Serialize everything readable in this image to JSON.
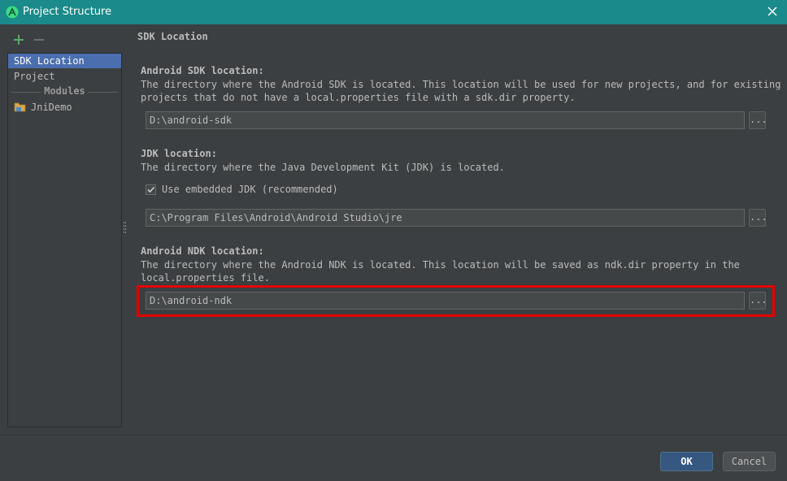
{
  "window": {
    "title": "Project Structure",
    "app_icon": "android-studio-icon",
    "close_icon": "close-icon"
  },
  "toolbar": {
    "add_icon": "plus-icon",
    "remove_icon": "minus-icon",
    "add_color": "#59a869"
  },
  "sidebar": {
    "items": [
      {
        "label": "SDK Location",
        "selected": true
      },
      {
        "label": "Project",
        "selected": false
      }
    ],
    "section_label": "Modules",
    "modules": [
      {
        "label": "JniDemo",
        "icon": "module-folder-icon"
      }
    ]
  },
  "main": {
    "section_title": "SDK Location",
    "sdk": {
      "heading": "Android SDK location:",
      "description_line1": "The directory where the Android SDK is located. This location will be used for new projects, and for existing",
      "description_line2": "projects that do not have a local.properties file with a sdk.dir property.",
      "path": "D:\\android-sdk",
      "browse_label": "..."
    },
    "jdk": {
      "heading": "JDK location:",
      "description": "The directory where the Java Development Kit (JDK) is located.",
      "embedded_label": "Use embedded JDK (recommended)",
      "embedded_checked": true,
      "path": "C:\\Program Files\\Android\\Android Studio\\jre",
      "browse_label": "..."
    },
    "ndk": {
      "heading": "Android NDK location:",
      "description_line1": "The directory where the Android NDK is located. This location will be saved as ndk.dir property in the",
      "description_line2": "local.properties file.",
      "path": "D:\\android-ndk",
      "browse_label": "...",
      "highlight_color": "#e50000"
    }
  },
  "footer": {
    "ok_label": "OK",
    "cancel_label": "Cancel"
  },
  "colors": {
    "background": "#3c3f41",
    "titlebar": "#1a8a8a",
    "selection": "#4b6eaf",
    "text": "#bbbbbb"
  }
}
